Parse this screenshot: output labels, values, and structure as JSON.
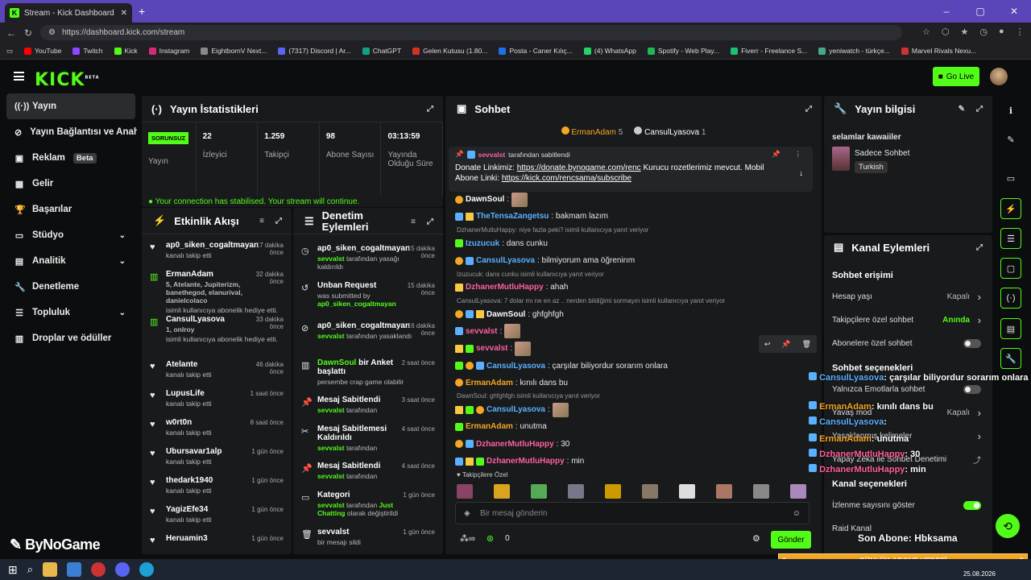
{
  "browser": {
    "tab_title": "Stream - Kick Dashboard",
    "url": "https://dashboard.kick.com/stream",
    "bookmarks": [
      "YouTube",
      "Twitch",
      "Kick",
      "Instagram",
      "EightbornV Next...",
      "(7317) Discord | Ar...",
      "ChatGPT",
      "Gelen Kutusu (1.80...",
      "Posta - Caner Kılıç...",
      "(4) WhatsApp",
      "Spotify - Web Play...",
      "Fiverr - Freelance S...",
      "yeniwatch - türkçe...",
      "Marvel Rivals Nexu..."
    ]
  },
  "topnav": {
    "logo": "KICK",
    "logo_sup": "BETA",
    "go_live": "Go Live"
  },
  "sidebar": {
    "items": [
      {
        "label": "Yayın",
        "icon": "broadcast-icon"
      },
      {
        "label": "Yayın Bağlantısı ve Anahtarı",
        "icon": "link-icon"
      },
      {
        "label": "Reklam",
        "icon": "ad-icon",
        "badge": "Beta"
      },
      {
        "label": "Gelir",
        "icon": "revenue-icon"
      },
      {
        "label": "Başarılar",
        "icon": "trophy-icon"
      },
      {
        "label": "Stüdyo",
        "icon": "studio-icon"
      },
      {
        "label": "Analitik",
        "icon": "analytics-icon"
      },
      {
        "label": "Denetleme",
        "icon": "wrench-icon"
      },
      {
        "label": "Topluluk",
        "icon": "community-icon"
      },
      {
        "label": "Droplar ve ödüller",
        "icon": "gift-icon"
      }
    ]
  },
  "watermark": "ByNoGame",
  "stats": {
    "title": "Yayın İstatistikleri",
    "status_badge": "SORUNSUZ",
    "status_label": "Yayın",
    "cells": [
      {
        "value": "22",
        "label": "İzleyici"
      },
      {
        "value": "1.259",
        "label": "Takipçi"
      },
      {
        "value": "98",
        "label": "Abone Sayısı"
      },
      {
        "value": "03:13:59",
        "label": "Yayında Olduğu Süre"
      }
    ],
    "stabilised": "Your connection has stabilised. Your stream will continue."
  },
  "activity": {
    "title": "Etkinlik Akışı",
    "events": [
      {
        "name": "ap0_siken_cogaltmayan",
        "sub": "kanalı takip etti",
        "time": "17 dakika önce"
      },
      {
        "name": "ErmanAdam",
        "gift": "5, Atelante, Jupiterizm, banethegod, elanurival, danielcolaco",
        "sub": "isimli kullanıcıya abonelik hediye etti.",
        "time": "32 dakika önce"
      },
      {
        "name": "CansulLyasova",
        "gift": "1, onlroy",
        "sub": "isimli kullanıcıya abonelik hediye etti.",
        "time": "33 dakika önce"
      },
      {
        "name": "Atelante",
        "sub": "kanalı takip etti",
        "time": "46 dakika önce"
      },
      {
        "name": "LupusLife",
        "sub": "kanalı takip etti",
        "time": "1 saat önce"
      },
      {
        "name": "w0rt0n",
        "sub": "kanalı takip etti",
        "time": "8 saat önce"
      },
      {
        "name": "Ubursavar1alp",
        "sub": "kanalı takip etti",
        "time": "1 gün önce"
      },
      {
        "name": "thedark1940",
        "sub": "kanalı takip etti",
        "time": "1 gün önce"
      },
      {
        "name": "YagizEfe34",
        "sub": "kanalı takip etti",
        "time": "1 gün önce"
      },
      {
        "name": "Heruamin3",
        "sub": "",
        "time": "1 gün önce"
      }
    ]
  },
  "moderation": {
    "title": "Denetim Eylemleri",
    "actions": [
      {
        "title": "ap0_siken_cogaltmayan",
        "user": "sevvalst",
        "sub": "tarafından yasağı kaldırıldı",
        "time": "15 dakika önce"
      },
      {
        "title": "Unban Request",
        "user": "",
        "sub": "was submitted by",
        "user2": "ap0_siken_cogaltmayan",
        "time": "15 dakika önce"
      },
      {
        "title": "ap0_siken_cogaltmayan",
        "user": "sevvalst",
        "sub": "tarafından yasaklandı",
        "time": "16 dakika önce"
      },
      {
        "title": "DawnSoul",
        "title2": "bir Anket başlattı",
        "user": "",
        "sub": "persembe crap game olabilir",
        "time": "2 saat önce"
      },
      {
        "title": "Mesaj Sabitlendi",
        "user": "sevvalst",
        "sub": "tarafından",
        "time": "3 saat önce"
      },
      {
        "title": "Mesaj Sabitlemesi Kaldırıldı",
        "user": "sevvalst",
        "sub": "tarafından",
        "time": "4 saat önce"
      },
      {
        "title": "Mesaj Sabitlendi",
        "user": "sevvalst",
        "sub": "tarafından",
        "time": "4 saat önce"
      },
      {
        "title": "Kategori",
        "user": "sevvalst",
        "sub": "tarafından",
        "cat": "Just Chatting",
        "sub2": "olarak değiştirildi",
        "time": "1 gün önce"
      },
      {
        "title": "sevvalst",
        "user": "",
        "sub": "bir mesajı sildi",
        "time": "1 gün önce"
      }
    ]
  },
  "chat": {
    "title": "Sohbet",
    "top": [
      {
        "name": "ErmanAdam",
        "count": "5"
      },
      {
        "name": "CansulLyasova",
        "count": "1"
      }
    ],
    "pinned": {
      "by": "sevvalst",
      "by_suffix": "tarafından sabitlendi",
      "text1": "Donate Linkimiz:",
      "link1": "https://donate.bynogame.com/renc",
      "text2": "Kurucu rozetlerimiz mevcut. Mobil Abone Linki:",
      "link2": "https://kick.com/rencsama/subscribe"
    },
    "messages": [
      {
        "user": "DawnSoul",
        "color": "#ffffff",
        "text": ":",
        "emote": true
      },
      {
        "user": "TheTensaZangetsu",
        "color": "#5bb0ff",
        "text": ": bakmam lazım"
      },
      {
        "reply": "DzhanerMutluHappy: niye fazla peki? isimli kullanıcıya yanıt veriyor"
      },
      {
        "user": "Izuzucuk",
        "color": "#5bb0ff",
        "text": ": dans cunku"
      },
      {
        "user": "CansulLyasova",
        "color": "#5bb0ff",
        "text": ": bilmiyorum ama öğrenirım"
      },
      {
        "reply": "Izuzucuk: dans cunku isimli kullanıcıya yanıt veriyor"
      },
      {
        "user": "DzhanerMutluHappy",
        "color": "#ff5fa2",
        "text": ": ahah"
      },
      {
        "reply": "CansulLyasova: 7 dolar mı ne en az .. nerden bildiğimi sormayın isimli kullanıcıya yanıt veriyor"
      },
      {
        "user": "DawnSoul",
        "color": "#ffffff",
        "text": ": ghfghfgh"
      },
      {
        "user": "sevvalst",
        "color": "#ff5fa2",
        "text": ":",
        "emote": true
      },
      {
        "user": "sevvalst",
        "color": "#ff5fa2",
        "text": ":",
        "emote": true
      },
      {
        "user": "CansulLyasova",
        "color": "#5bb0ff",
        "text": ": çarşılar biliyordur sorarım onlara"
      },
      {
        "user": "ErmanAdam",
        "color": "#f5a623",
        "text": ": kınılı dans bu"
      },
      {
        "reply": "DawnSoul: ghfghfgh isimli kullanıcıya yanıt veriyor"
      },
      {
        "user": "CansulLyasova",
        "color": "#5bb0ff",
        "text": ":",
        "emote": true
      },
      {
        "user": "ErmanAdam",
        "color": "#f5a623",
        "text": ": unutma"
      },
      {
        "user": "DzhanerMutluHappy",
        "color": "#ff5fa2",
        "text": ": 30"
      },
      {
        "user": "DzhanerMutluHappy",
        "color": "#ff5fa2",
        "text": ": min"
      }
    ],
    "followers_only": "Takipçilere Özel",
    "input_placeholder": "Bir mesaj gönderin",
    "points": "0",
    "send": "Gönder"
  },
  "stream_info": {
    "title": "Yayın bilgisi",
    "stream_title": "selamlar kawaiiler",
    "category": "Sadece Sohbet",
    "tag": "Turkish"
  },
  "channel_actions": {
    "title": "Kanal Eylemleri",
    "chat_access": "Sohbet erişimi",
    "rows1": [
      {
        "label": "Hesap yaşı",
        "value": "Kapalı",
        "kind": "chevron"
      },
      {
        "label": "Takipçilere özel sohbet",
        "value": "Anında",
        "kind": "chevron",
        "green": true
      },
      {
        "label": "Abonelere özel sohbet",
        "kind": "toggle",
        "on": false
      }
    ],
    "chat_options": "Sohbet seçenekleri",
    "rows2": [
      {
        "label": "Yalnızca Emotlarla sohbet",
        "kind": "toggle",
        "on": false
      },
      {
        "label": "Yavaş mod",
        "value": "Kapalı",
        "kind": "chevron"
      },
      {
        "label": "Yasaklanmış kelimeler",
        "kind": "chevron"
      },
      {
        "label": "Yapay Zeka ile Sohbet Denetimi",
        "kind": "external"
      }
    ],
    "channel_options": "Kanal seçenekleri",
    "rows3": [
      {
        "label": "İzlenme sayısını göster",
        "kind": "toggle",
        "on": true
      },
      {
        "label": "Raid Kanal",
        "kind": "none"
      }
    ]
  },
  "overlay": {
    "lines": [
      {
        "user": "CansulLyasova",
        "text": ": çarşılar biliyordur sorarım onlara",
        "color": "#5bb0ff"
      },
      {
        "user": "ErmanAdam",
        "text": ": kınılı dans bu",
        "color": "#f5a623"
      },
      {
        "user": "CansulLyasova",
        "text": ":",
        "color": "#5bb0ff"
      },
      {
        "user": "ErmanAdam",
        "text": ": unutma",
        "color": "#f5a623"
      },
      {
        "user": "DzhanerMutluHappy",
        "text": ": 30",
        "color": "#ff5fa2"
      },
      {
        "user": "DzhanerMutluHappy",
        "text": ": min",
        "color": "#ff5fa2"
      }
    ],
    "last_sub": "Son Abone: Hbksama",
    "goal_left": "6",
    "goal_label": "GÜNLÜK ABONE HEDEFİ",
    "goal_right": "5"
  },
  "taskbar": {
    "date": "25.08.2026"
  },
  "colors": {
    "accent": "#53fc18",
    "purple": "#5b45b9",
    "panel": "#181a1c"
  }
}
